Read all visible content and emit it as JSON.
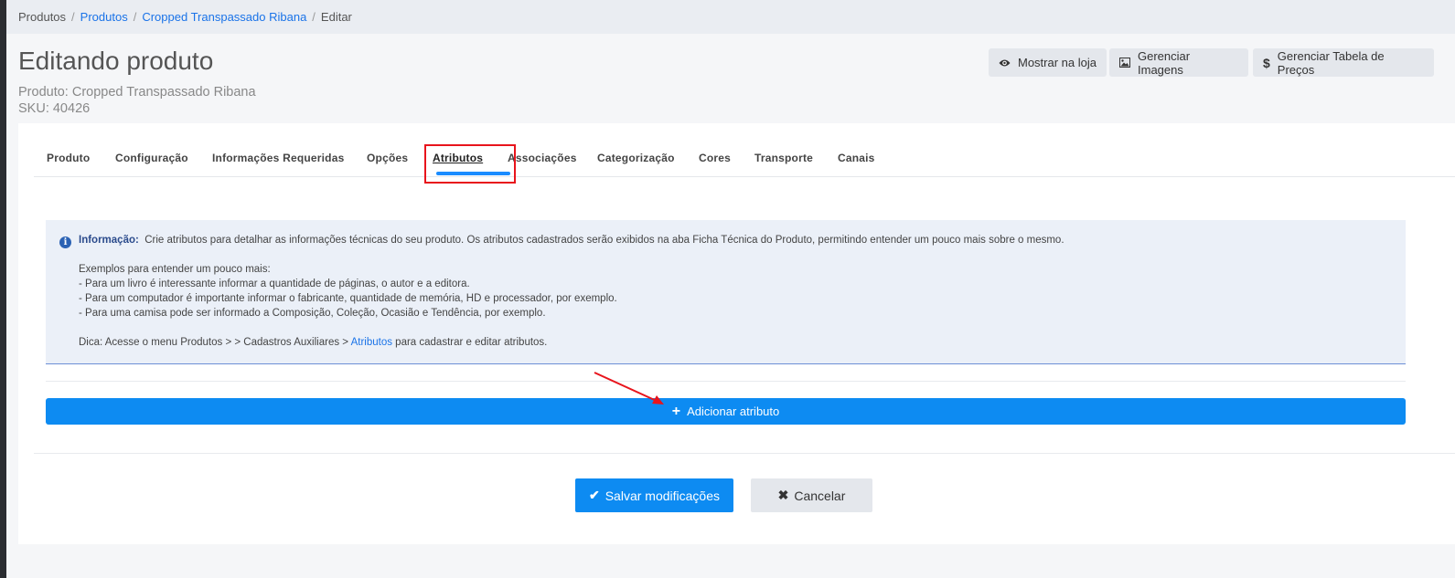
{
  "breadcrumb": [
    {
      "label": "Produtos",
      "link": false
    },
    {
      "label": "Produtos",
      "link": true
    },
    {
      "label": "Cropped Transpassado Ribana",
      "link": true
    },
    {
      "label": "Editar",
      "link": false
    }
  ],
  "breadcrumb_separator": "/",
  "header": {
    "title": "Editando produto",
    "product_line": "Produto: Cropped Transpassado Ribana",
    "sku_line": "SKU: 40426",
    "buttons": {
      "show_store": {
        "label": "Mostrar na loja",
        "icon": "eye-icon"
      },
      "manage_images": {
        "label": "Gerenciar Imagens",
        "icon": "image-icon"
      },
      "manage_prices": {
        "label": "Gerenciar Tabela de Preços",
        "icon": "dollar-icon"
      }
    }
  },
  "tabs": [
    {
      "label": "Produto",
      "active": false
    },
    {
      "label": "Configuração",
      "active": false
    },
    {
      "label": "Informações Requeridas",
      "active": false
    },
    {
      "label": "Opções",
      "active": false
    },
    {
      "label": "Atributos",
      "active": true
    },
    {
      "label": "Associações",
      "active": false
    },
    {
      "label": "Categorização",
      "active": false
    },
    {
      "label": "Cores",
      "active": false
    },
    {
      "label": "Transporte",
      "active": false
    },
    {
      "label": "Canais",
      "active": false
    }
  ],
  "info": {
    "label": "Informação:",
    "text": "Crie atributos para detalhar as informações técnicas do seu produto. Os atributos cadastrados serão exibidos na aba Ficha Técnica do Produto, permitindo entender um pouco mais sobre o mesmo.",
    "examples_title": "Exemplos para entender um pouco mais:",
    "examples": [
      "- Para um livro é interessante informar a quantidade de páginas, o autor e a editora.",
      "- Para um computador é importante informar o fabricante, quantidade de memória, HD e processador, por exemplo.",
      "- Para uma camisa pode ser informado a Composição, Coleção, Ocasião e Tendência, por exemplo."
    ],
    "tip_prefix": "Dica: Acesse o menu Produtos > > Cadastros Auxiliares >",
    "tip_link": "Atributos",
    "tip_suffix": "para cadastrar e editar atributos."
  },
  "add_attribute_label": "Adicionar atributo",
  "save_label": "Salvar modificações",
  "cancel_label": "Cancelar",
  "colors": {
    "primary": "#0d8bf2",
    "highlight": "#e8141c",
    "info_bg": "#ebf0f8"
  }
}
